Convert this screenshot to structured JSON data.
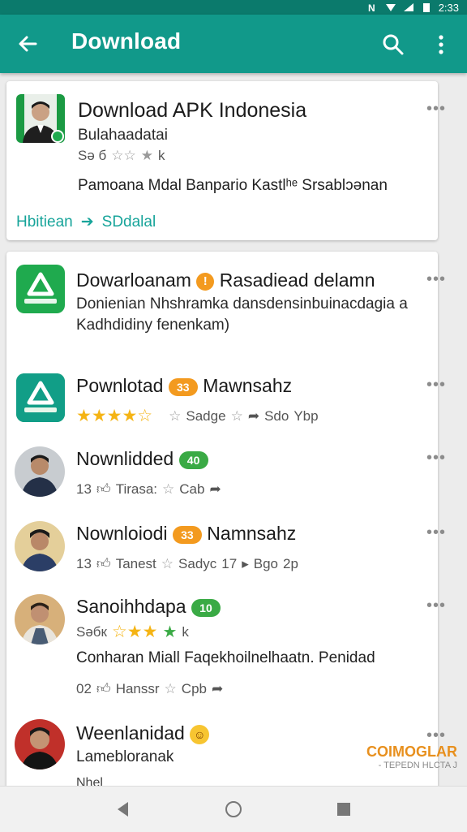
{
  "status_bar": {
    "time": "2:33",
    "icons": [
      "nfc-icon",
      "wifi-icon",
      "signal-icon",
      "battery-icon"
    ]
  },
  "app_bar": {
    "title": "Download",
    "icons": [
      "back-arrow-icon",
      "search-icon",
      "overflow-menu-icon"
    ]
  },
  "featured_card": {
    "title": "Download APK Indonesia",
    "subtitle": "Bulahaadatai",
    "meta_prefix": "Sə б",
    "meta_suffix": "k",
    "description": "Pamoana Mdal Banpario Kastlʰᵉ Srsablɔənan",
    "link_left": "Hbitiean",
    "link_right": "SDdalal"
  },
  "list": [
    {
      "title": "Dowarloanam",
      "title_after": "Rasadiead delamn",
      "badge": "!",
      "line1": "Donienian Nhshramka dansdensinbuinacdagia a",
      "line2": "Kadhdidiny fenenkam)"
    },
    {
      "title": "Pownlotad",
      "badge": "33",
      "title_after": "Mawnsahz",
      "meta_a": "Sadge",
      "meta_b": "Sdo",
      "meta_c": "Ybp"
    },
    {
      "title": "Nownlidded",
      "badge": "40",
      "meta_a": "13",
      "meta_b": "Tirasa:",
      "meta_c": "Cab"
    },
    {
      "title": "Nownloiodi",
      "badge": "33",
      "title_after": "Namnsahz",
      "meta_a": "13",
      "meta_b": "Tanest",
      "meta_c": "Sadyc",
      "meta_d": "17",
      "meta_e": "Bgo",
      "meta_f": "2p"
    },
    {
      "title": "Sanoihhdapa",
      "badge": "10",
      "meta_prefix": "Səбк",
      "meta_suffix": "k",
      "line1": "Conharan Miall Faqekhoilnelhaatn. Penidad",
      "meta_a": "02",
      "meta_b": "Hanssr",
      "meta_c": "Cpb"
    },
    {
      "title": "Weenlanidad",
      "line1": "Lamebloranak",
      "line2": "Nhel"
    }
  ],
  "watermark": {
    "line1": "COIMOGLAR",
    "line2": "- TEPEDN HLCTA J"
  },
  "nav": {
    "icons": [
      "back-triangle-icon",
      "home-circle-icon",
      "recents-square-icon"
    ]
  },
  "colors": {
    "appbar": "#11998a",
    "statusbar": "#0b7a6c",
    "accent": "#17a49a",
    "badge_orange": "#f39a1f",
    "badge_green": "#3aaa45",
    "star": "#f5b414"
  }
}
